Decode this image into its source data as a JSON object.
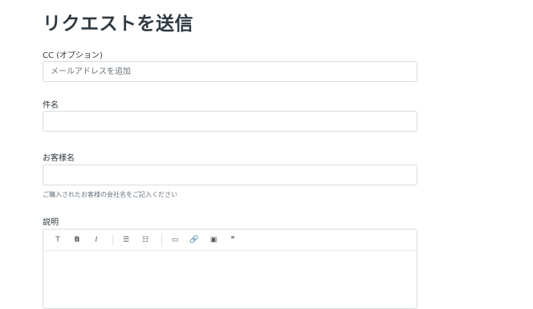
{
  "page": {
    "title": "リクエストを送信"
  },
  "cc": {
    "label": "CC (オプション)",
    "placeholder": "メールアドレスを追加",
    "value": ""
  },
  "subject": {
    "label": "件名",
    "value": ""
  },
  "customer": {
    "label": "お客様名",
    "value": "",
    "hint": "ご購入されたお客様の会社名をご記入ください"
  },
  "description": {
    "label": "説明",
    "toolbar": {
      "text": "T",
      "bold": "B",
      "italic": "I",
      "bullet_list": "☰",
      "numbered_list": "☷",
      "code": "▭",
      "link": "🔗",
      "image": "▣",
      "quote": "❞"
    }
  }
}
